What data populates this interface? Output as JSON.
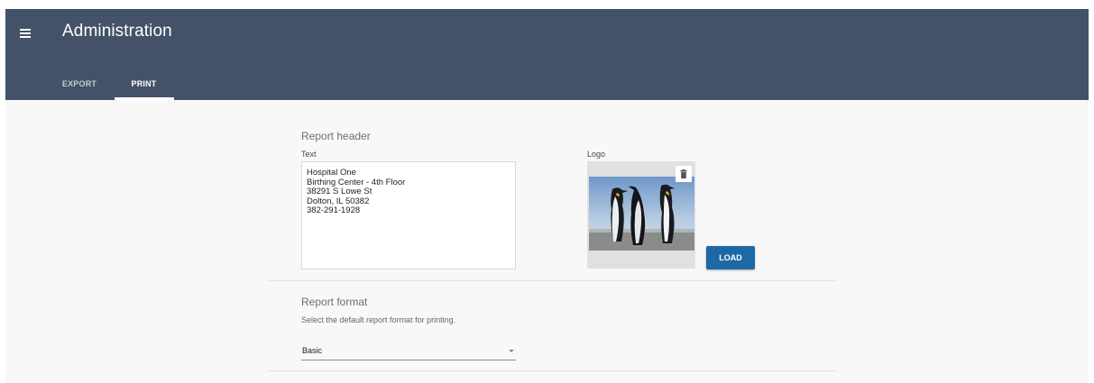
{
  "app_bar": {
    "title": "Administration",
    "menu_icon": "menu-icon",
    "background": "#435268"
  },
  "tabs": [
    {
      "label": "EXPORT",
      "active": false
    },
    {
      "label": "PRINT",
      "active": true
    }
  ],
  "report_header": {
    "section_title": "Report header",
    "text_label": "Text",
    "text_value": "Hospital One\nBirthing Center - 4th Floor\n38291 S Lowe St\nDolton, IL 50382\n382-291-1928",
    "logo_label": "Logo",
    "logo_image": "penguins",
    "delete_icon": "trash-icon",
    "load_button": "LOAD"
  },
  "report_format": {
    "section_title": "Report format",
    "description": "Select the default report format for printing.",
    "selected": "Basic",
    "dropdown_icon": "chevron-down-icon"
  },
  "colors": {
    "accent_button": "#1e68a6",
    "page_background": "#f8f8f8"
  }
}
